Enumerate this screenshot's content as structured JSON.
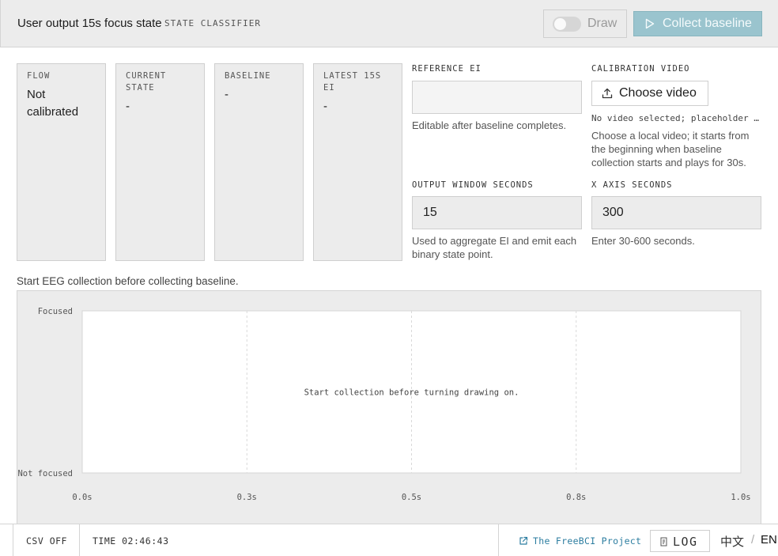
{
  "header": {
    "title": "User output 15s focus state",
    "subtitle": "STATE CLASSIFIER",
    "draw_label": "Draw",
    "collect_label": "Collect baseline"
  },
  "cards": [
    {
      "label": "FLOW",
      "value": "Not calibrated"
    },
    {
      "label": "CURRENT STATE",
      "value": "-"
    },
    {
      "label": "BASELINE",
      "value": "-"
    },
    {
      "label": "LATEST 15S EI",
      "value": "-"
    }
  ],
  "reference": {
    "label": "REFERENCE EI",
    "value": "",
    "help": "Editable after baseline completes."
  },
  "calibration": {
    "label": "CALIBRATION VIDEO",
    "button_label": "Choose video",
    "status": "No video selected; placeholder will be shown",
    "help": "Choose a local video; it starts from the beginning when baseline collection starts and plays for 30s."
  },
  "output_window": {
    "label": "OUTPUT WINDOW SECONDS",
    "value": "15",
    "help": "Used to aggregate EI and emit each binary state point."
  },
  "x_axis": {
    "label": "X AXIS SECONDS",
    "value": "300",
    "help": "Enter 30-600 seconds."
  },
  "status_line": "Start EEG collection before collecting baseline.",
  "chart_data": {
    "type": "line",
    "title": "",
    "xlabel": "",
    "ylabel": "",
    "y_categories": [
      "Not focused",
      "Focused"
    ],
    "x_ticks": [
      "0.0s",
      "0.3s",
      "0.5s",
      "0.8s",
      "1.0s"
    ],
    "xlim": [
      0,
      1.0
    ],
    "series": [],
    "empty_message": "Start collection before turning drawing on."
  },
  "footer": {
    "csv": "CSV OFF",
    "time": "TIME 02:46:43",
    "link": "The FreeBCI Project",
    "log": "LOG",
    "lang_zh": "中文",
    "lang_sep": "/",
    "lang_en": "EN"
  },
  "colors": {
    "accent": "#9ac4ce",
    "link": "#2c7da0",
    "panel": "#ececec"
  }
}
